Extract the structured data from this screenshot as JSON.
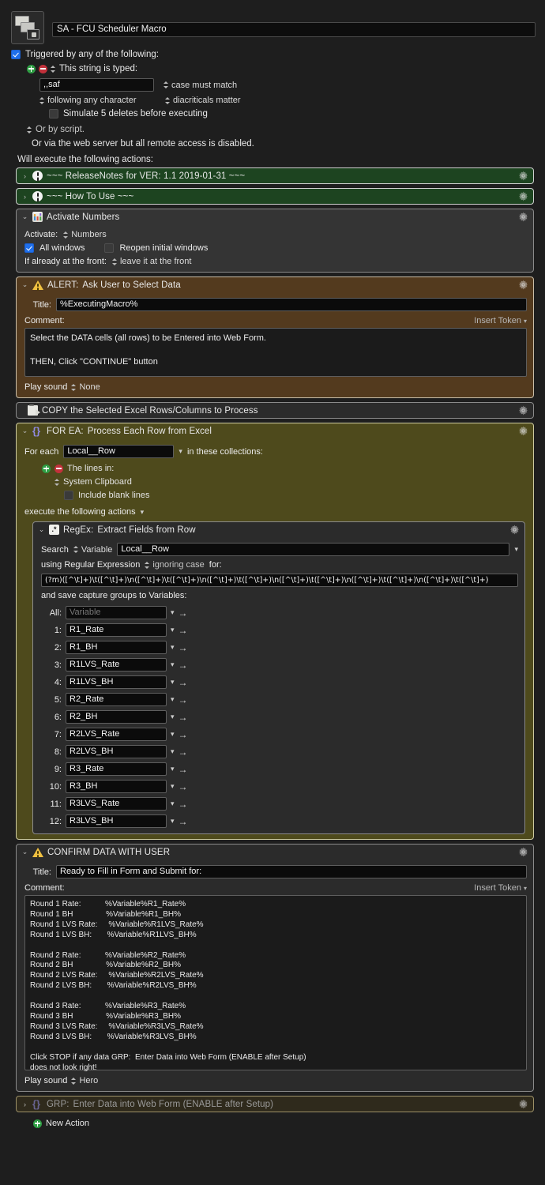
{
  "macro": {
    "icon": "stacked-windows-icon",
    "name": "SA - FCU Scheduler Macro"
  },
  "trigger": {
    "enabled_label": "Triggered by any of the following:",
    "type_label": "This string is typed:",
    "typed_string": ",,saf",
    "case_option": "case must match",
    "following_option": "following any character",
    "diacritics_option": "diacriticals matter",
    "simulate_deletes_label": "Simulate 5 deletes before executing",
    "or_by_script": "Or by script.",
    "web_server_note": "Or via the web server but all remote access is disabled."
  },
  "will_execute_label": "Will execute the following actions:",
  "actions": {
    "release_notes": {
      "title": "~~~ ReleaseNotes for VER: 1.1    2019-01-31 ~~~",
      "icon": "exclamation-icon",
      "color": "#1d4420"
    },
    "how_to_use": {
      "title": "~~~ How To Use ~~~",
      "icon": "exclamation-icon",
      "color": "#1d4420"
    },
    "activate_numbers": {
      "title": "Activate Numbers",
      "icon": "numbers-app-icon",
      "activate_label": "Activate:",
      "activate_value": "Numbers",
      "all_windows_label": "All windows",
      "all_windows_checked": true,
      "reopen_label": "Reopen initial windows",
      "reopen_checked": false,
      "front_label": "If already at the front:",
      "front_value": "leave it at the front"
    },
    "alert": {
      "title_prefix": "ALERT:",
      "title": "Ask User to Select Data",
      "icon": "warning-triangle-icon",
      "color": "#533a1e",
      "title_field_label": "Title:",
      "title_field_value": "%ExecutingMacro%",
      "comment_label": "Comment:",
      "insert_token_label": "Insert Token",
      "comment_body": "Select the DATA cells (all rows) to be Entered into Web Form.\n\nTHEN, Click \"CONTINUE\" button",
      "play_sound_label": "Play sound",
      "play_sound_value": "None"
    },
    "copy_action": {
      "title": "COPY the Selected Excel Rows/Columns to Process",
      "icon": "copy-clipboard-icon"
    },
    "for_each": {
      "title_prefix": "FOR EA:",
      "title": "Process Each Row from Excel",
      "icon": "braces-icon",
      "color": "#4e4a1c",
      "for_each_label": "For each",
      "variable": "Local__Row",
      "in_collections_label": "in these collections:",
      "lines_in_label": "The lines in:",
      "source_value": "System Clipboard",
      "include_blank_label": "Include blank lines",
      "include_blank_checked": false,
      "execute_label": "execute the following actions"
    },
    "regex": {
      "title_prefix": "RegEx:",
      "title": "Extract Fields from Row",
      "icon": "regex-icon",
      "search_label": "Search",
      "search_source": "Variable",
      "search_variable": "Local__Row",
      "using_label": "using Regular Expression",
      "case_option": "ignoring case",
      "for_label": "for:",
      "pattern": "(?m)([^\\t]+)\\t([^\\t]+)\\n([^\\t]+)\\t([^\\t]+)\\n([^\\t]+)\\t([^\\t]+)\\n([^\\t]+)\\t([^\\t]+)\\n([^\\t]+)\\t([^\\t]+)\\n([^\\t]+)\\t([^\\t]+)",
      "save_label": "and save capture groups to Variables:",
      "groups": [
        {
          "num": "All:",
          "value": "",
          "placeholder": "Variable"
        },
        {
          "num": "1:",
          "value": "R1_Rate"
        },
        {
          "num": "2:",
          "value": "R1_BH"
        },
        {
          "num": "3:",
          "value": "R1LVS_Rate"
        },
        {
          "num": "4:",
          "value": "R1LVS_BH"
        },
        {
          "num": "5:",
          "value": "R2_Rate"
        },
        {
          "num": "6:",
          "value": "R2_BH"
        },
        {
          "num": "7:",
          "value": "R2LVS_Rate"
        },
        {
          "num": "8:",
          "value": "R2LVS_BH"
        },
        {
          "num": "9:",
          "value": "R3_Rate"
        },
        {
          "num": "10:",
          "value": "R3_BH"
        },
        {
          "num": "11:",
          "value": "R3LVS_Rate"
        },
        {
          "num": "12:",
          "value": "R3LVS_BH"
        }
      ]
    },
    "confirm": {
      "title": "CONFIRM DATA WITH USER",
      "icon": "warning-triangle-icon",
      "title_field_label": "Title:",
      "title_field_value": "Ready to Fill in Form and Submit for:",
      "comment_label": "Comment:",
      "insert_token_label": "Insert Token",
      "comment_body": "Round 1 Rate:           %Variable%R1_Rate%\nRound 1 BH               %Variable%R1_BH%\nRound 1 LVS Rate:     %Variable%R1LVS_Rate%\nRound 1 LVS BH:       %Variable%R1LVS_BH%\n\nRound 2 Rate:           %Variable%R2_Rate%\nRound 2 BH               %Variable%R2_BH%\nRound 2 LVS Rate:     %Variable%R2LVS_Rate%\nRound 2 LVS BH:       %Variable%R2LVS_BH%\n\nRound 3 Rate:           %Variable%R3_Rate%\nRound 3 BH               %Variable%R3_BH%\nRound 3 LVS Rate:     %Variable%R3LVS_Rate%\nRound 3 LVS BH:       %Variable%R3LVS_BH%\n\nClick STOP if any data GRP:  Enter Data into Web Form (ENABLE after Setup)\ndoes not look right!",
      "play_sound_label": "Play sound",
      "play_sound_value": "Hero"
    },
    "group_web_form": {
      "title_prefix": "GRP:",
      "title": "Enter Data into Web Form (ENABLE after Setup)",
      "icon": "braces-icon",
      "disabled": true
    }
  },
  "new_action_label": "New Action"
}
